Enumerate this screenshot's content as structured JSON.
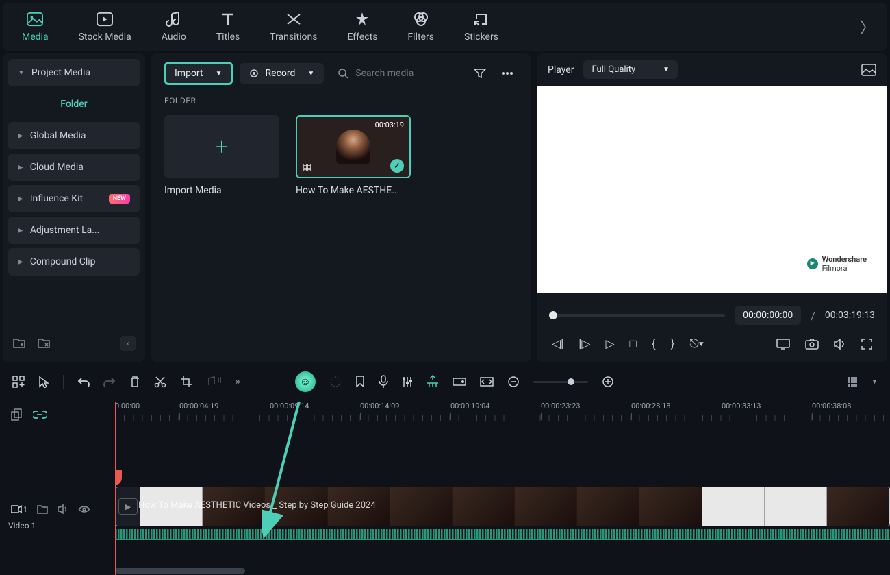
{
  "tabs": {
    "media": "Media",
    "stock": "Stock Media",
    "audio": "Audio",
    "titles": "Titles",
    "transitions": "Transitions",
    "effects": "Effects",
    "filters": "Filters",
    "stickers": "Stickers"
  },
  "sidebar": {
    "project_media": "Project Media",
    "folder": "Folder",
    "global": "Global Media",
    "cloud": "Cloud Media",
    "influence": "Influence Kit",
    "new_badge": "NEW",
    "adjustment": "Adjustment La...",
    "compound": "Compound Clip"
  },
  "toolbar": {
    "import": "Import",
    "record": "Record",
    "search_placeholder": "Search media"
  },
  "mediaSection": {
    "label": "FOLDER",
    "import_card": "Import Media",
    "clip1_name": "How To Make AESTHE...",
    "clip1_duration": "00:03:19"
  },
  "player": {
    "label": "Player",
    "quality": "Full Quality",
    "watermark_line1": "Wondershare",
    "watermark_line2": "Filmora",
    "current_time": "00:00:00:00",
    "separator": "/",
    "total_time": "00:03:19:13"
  },
  "timeline": {
    "track_label": "Video 1",
    "track_badge": "1",
    "clip_title": "How To Make AESTHETIC Videos _ Step by Step Guide 2024",
    "ticks": [
      "0:00:00",
      "00:00:04:19",
      "00:00:09:14",
      "00:00:14:09",
      "00:00:19:04",
      "00:00:23:23",
      "00:00:28:18",
      "00:00:33:13",
      "00:00:38:08"
    ]
  }
}
